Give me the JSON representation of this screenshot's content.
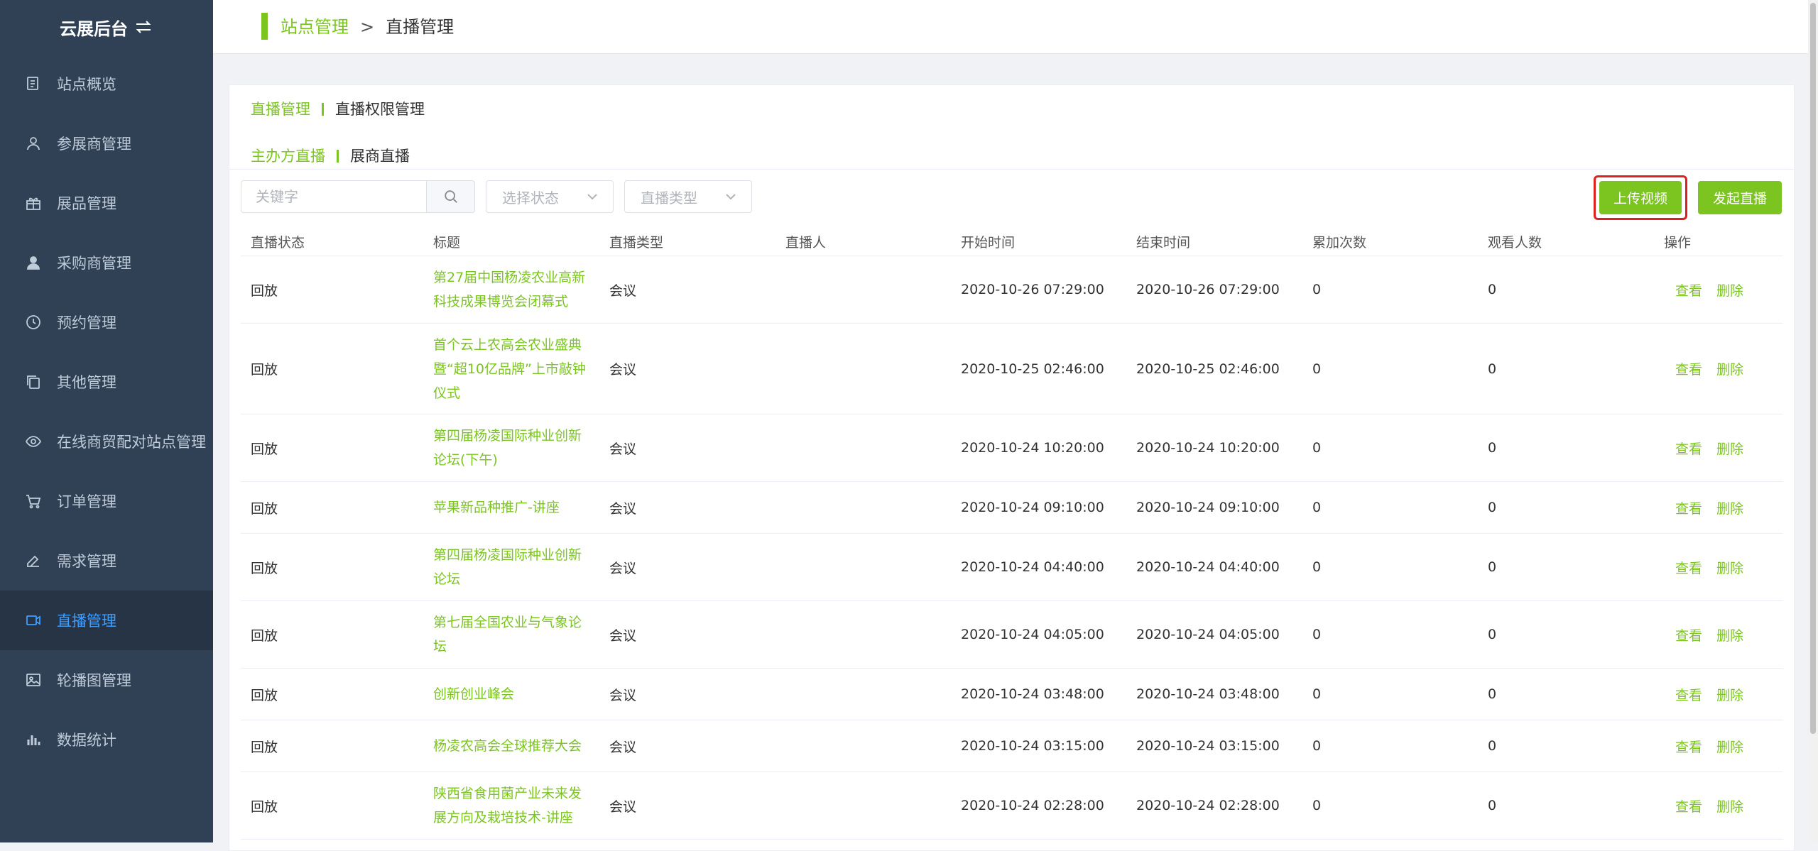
{
  "sidebar": {
    "brand": "云展后台",
    "items": [
      {
        "label": "站点概览",
        "icon": "overview-icon"
      },
      {
        "label": "参展商管理",
        "icon": "user-icon"
      },
      {
        "label": "展品管理",
        "icon": "gift-icon"
      },
      {
        "label": "采购商管理",
        "icon": "person-icon"
      },
      {
        "label": "预约管理",
        "icon": "clock-icon"
      },
      {
        "label": "其他管理",
        "icon": "copy-icon"
      },
      {
        "label": "在线商贸配对站点管理",
        "icon": "eye-icon"
      },
      {
        "label": "订单管理",
        "icon": "cart-icon"
      },
      {
        "label": "需求管理",
        "icon": "edit-icon"
      },
      {
        "label": "直播管理",
        "icon": "video-icon",
        "active": true
      },
      {
        "label": "轮播图管理",
        "icon": "image-icon"
      },
      {
        "label": "数据统计",
        "icon": "bar-chart-icon"
      }
    ]
  },
  "header": {
    "crumb_parent": "站点管理",
    "crumb_sep": ">",
    "crumb_current": "直播管理"
  },
  "tabs_primary": {
    "active": "直播管理",
    "other": "直播权限管理"
  },
  "tabs_secondary": {
    "active": "主办方直播",
    "other": "展商直播"
  },
  "filters": {
    "keyword_placeholder": "关键字",
    "status_placeholder": "选择状态",
    "type_placeholder": "直播类型"
  },
  "actions": {
    "upload": "上传视频",
    "start_live": "发起直播"
  },
  "colors": {
    "accent": "#7cc520",
    "sidebar_bg": "#304156",
    "active_menu": "#409eff",
    "highlight": "#e0201c"
  },
  "table": {
    "headers": [
      "直播状态",
      "标题",
      "直播类型",
      "直播人",
      "开始时间",
      "结束时间",
      "累加次数",
      "观看人数",
      "操作"
    ],
    "op_view": "查看",
    "op_delete": "删除",
    "rows": [
      {
        "status": "回放",
        "title": "第27届中国杨凌农业高新科技成果博览会闭幕式",
        "type": "会议",
        "host": "",
        "start": "2020-10-26 07:29:00",
        "end": "2020-10-26 07:29:00",
        "count": "0",
        "viewers": "0"
      },
      {
        "status": "回放",
        "title": "首个云上农高会农业盛典暨“超10亿品牌”上市敲钟仪式",
        "type": "会议",
        "host": "",
        "start": "2020-10-25 02:46:00",
        "end": "2020-10-25 02:46:00",
        "count": "0",
        "viewers": "0"
      },
      {
        "status": "回放",
        "title": "第四届杨凌国际种业创新论坛(下午)",
        "type": "会议",
        "host": "",
        "start": "2020-10-24 10:20:00",
        "end": "2020-10-24 10:20:00",
        "count": "0",
        "viewers": "0"
      },
      {
        "status": "回放",
        "title": "苹果新品种推广-讲座",
        "type": "会议",
        "host": "",
        "start": "2020-10-24 09:10:00",
        "end": "2020-10-24 09:10:00",
        "count": "0",
        "viewers": "0"
      },
      {
        "status": "回放",
        "title": "第四届杨凌国际种业创新论坛",
        "type": "会议",
        "host": "",
        "start": "2020-10-24 04:40:00",
        "end": "2020-10-24 04:40:00",
        "count": "0",
        "viewers": "0"
      },
      {
        "status": "回放",
        "title": "第七届全国农业与气象论坛",
        "type": "会议",
        "host": "",
        "start": "2020-10-24 04:05:00",
        "end": "2020-10-24 04:05:00",
        "count": "0",
        "viewers": "0"
      },
      {
        "status": "回放",
        "title": "创新创业峰会",
        "type": "会议",
        "host": "",
        "start": "2020-10-24 03:48:00",
        "end": "2020-10-24 03:48:00",
        "count": "0",
        "viewers": "0"
      },
      {
        "status": "回放",
        "title": "杨凌农高会全球推荐大会",
        "type": "会议",
        "host": "",
        "start": "2020-10-24 03:15:00",
        "end": "2020-10-24 03:15:00",
        "count": "0",
        "viewers": "0"
      },
      {
        "status": "回放",
        "title": "陕西省食用菌产业未来发展方向及栽培技术-讲座",
        "type": "会议",
        "host": "",
        "start": "2020-10-24 02:28:00",
        "end": "2020-10-24 02:28:00",
        "count": "0",
        "viewers": "0"
      }
    ]
  }
}
